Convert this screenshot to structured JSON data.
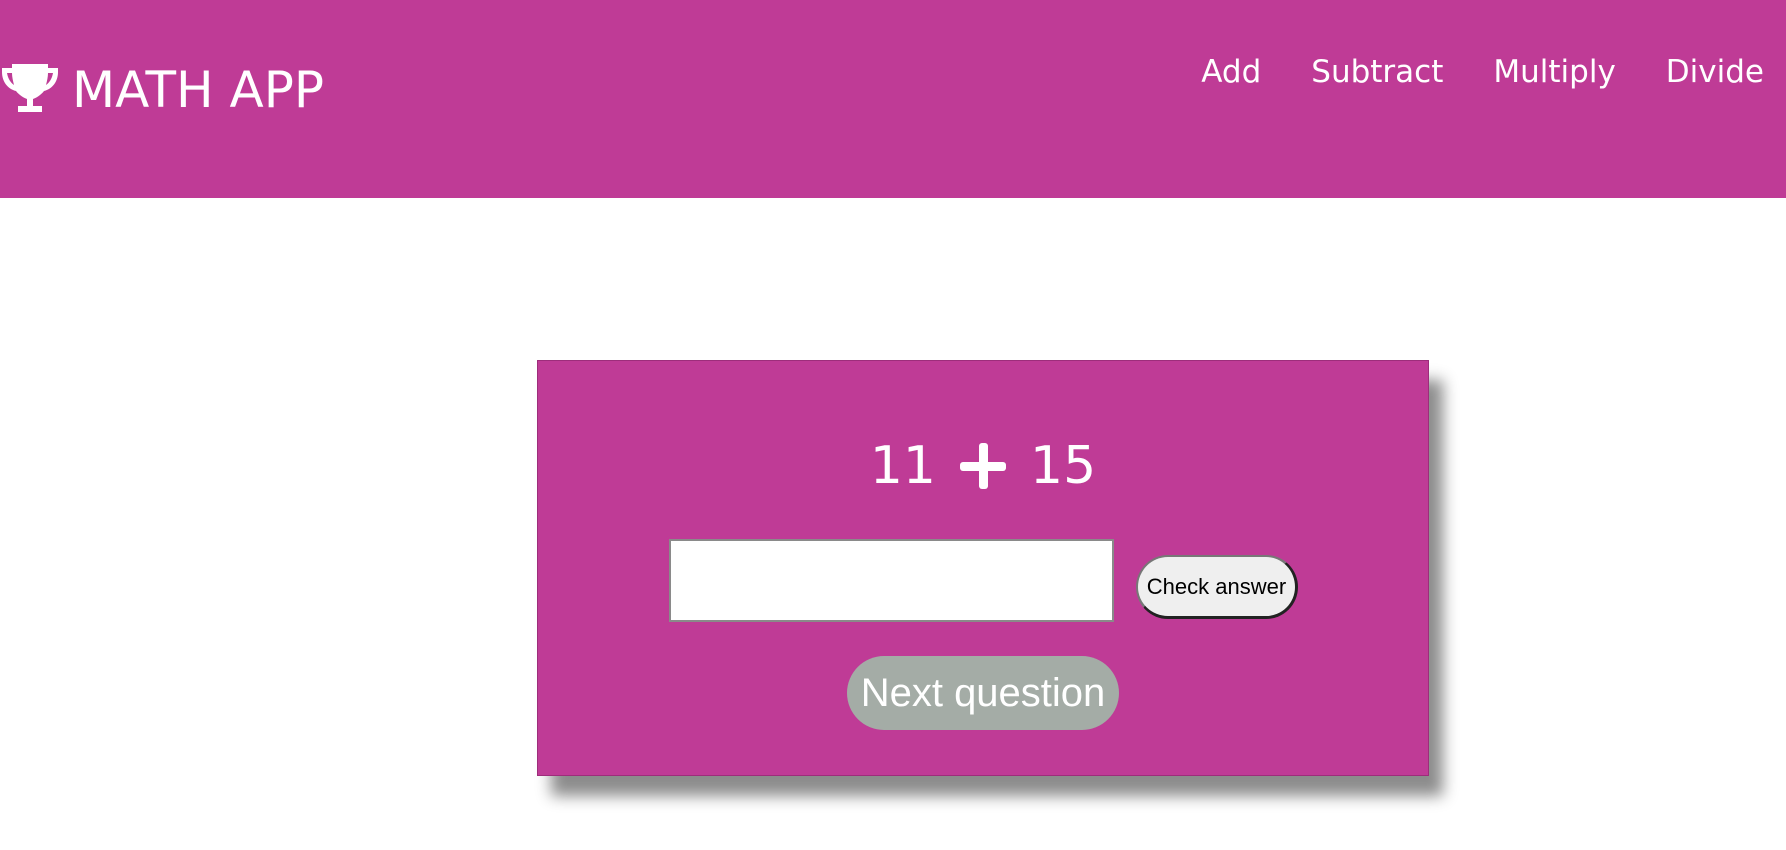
{
  "header": {
    "title": "MATH APP",
    "logo_icon": "trophy-icon",
    "nav": [
      "Add",
      "Subtract",
      "Multiply",
      "Divide"
    ]
  },
  "problem": {
    "operand_a": "11",
    "operator_icon": "plus-icon",
    "operand_b": "15"
  },
  "answer": {
    "value": "",
    "placeholder": ""
  },
  "buttons": {
    "check_label": "Check answer",
    "next_label": "Next question"
  },
  "colors": {
    "brand": "#bf3b96",
    "next_button": "#a4aca6",
    "check_button": "#efefef"
  }
}
